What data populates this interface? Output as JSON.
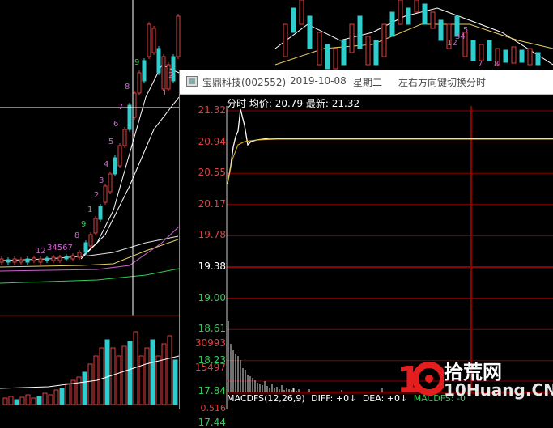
{
  "background_candles": {
    "count_labels": [
      "12",
      "34567",
      "8",
      "9",
      "1",
      "2",
      "3",
      "4",
      "5",
      "6",
      "7",
      "8",
      "9",
      "1",
      "2",
      "12",
      "34",
      "5",
      "7",
      "8"
    ]
  },
  "popup": {
    "stock_name": "宝鼎科技(002552)",
    "date": "2019-10-08",
    "weekday": "星期二",
    "hint": "左右方向键切换分时",
    "header": {
      "mode": "分时",
      "avg_label": "均价:",
      "avg_value": "20.79",
      "latest_label": "最新:",
      "latest_value": "21.32"
    },
    "price_levels": [
      "21.32",
      "20.94",
      "20.55",
      "20.17",
      "19.78",
      "19.38",
      "19.00",
      "18.61",
      "18.23",
      "17.84",
      "17.44"
    ],
    "volume_levels": [
      "30993",
      "15497"
    ],
    "bottom_label": "0.516",
    "macd": {
      "name": "MACDFS(12,26,9)",
      "diff": "DIFF: +0↓",
      "dea": "DEA: +0↓",
      "macdfs": "MACDFS: -0"
    },
    "colors": {
      "up": "#e04040",
      "down": "#33cc55",
      "base": "#ffffff",
      "grid": "#8b0000"
    }
  },
  "logo": {
    "brand": "拾荒网",
    "site": "10Huang.CN"
  }
}
